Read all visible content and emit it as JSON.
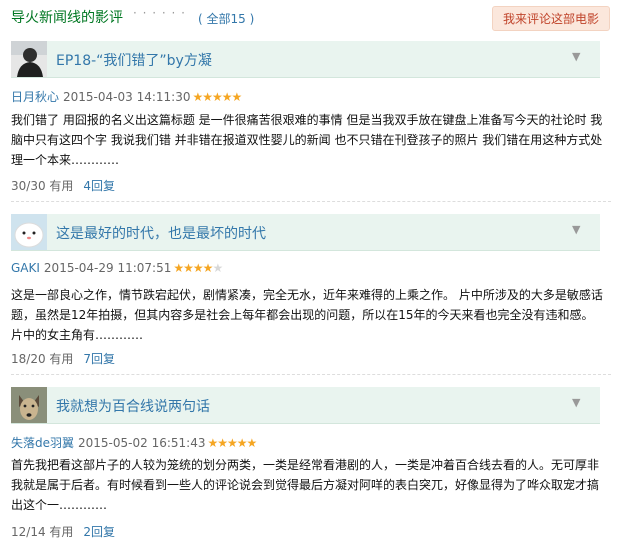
{
  "header": {
    "title": "导火新闻线的影评",
    "dots": "· · · · · ·",
    "count": "( 全部15 )",
    "write_button": "我来评论这部电影"
  },
  "reviews": [
    {
      "title": "EP18-“我们错了”by方凝",
      "author": "日月秋心",
      "date": "2015-04-03 14:11:30",
      "rating": 5,
      "avatar": "avatar-dark-figure",
      "body": "我们错了 用囧报的名义出这篇标题 是一件很痛苦很艰难的事情 但是当我双手放在键盘上准备写今天的社论时 我脑中只有这四个字 我说我们错 并非错在报道双性婴儿的新闻 也不只错在刊登孩子的照片 我们错在用这种方式处理一个本来…………",
      "useful": "30/30 有用",
      "replies": "4回复"
    },
    {
      "title": "这是最好的时代，也是最坏的时代",
      "author": "GAKI",
      "date": "2015-04-29 11:07:51",
      "rating": 4,
      "avatar": "avatar-white-creature",
      "body": "这是一部良心之作，情节跌宕起伏，剧情紧凑，完全无水，近年来难得的上乘之作。 片中所涉及的大多是敏感话题，虽然是12年拍摄，但其内容多是社会上每年都会出现的问题，所以在15年的今天来看也完全没有违和感。 片中的女主角有…………",
      "useful": "18/20 有用",
      "replies": "7回复"
    },
    {
      "title": "我就想为百合线说两句话",
      "author": "失落de羽翼",
      "date": "2015-05-02 16:51:43",
      "rating": 5,
      "avatar": "avatar-dog",
      "body": "首先我把看这部片子的人较为笼统的划分两类，一类是经常看港剧的人，一类是冲着百合线去看的人。无可厚非我就是属于后者。有时候看到一些人的评论说会到觉得最后方凝对阿咩的表白突兀，好像显得为了哗众取宠才搞出这个一…………",
      "useful": "12/14 有用",
      "replies": "2回复"
    }
  ],
  "icons": {
    "caret": "caret-down-icon",
    "star": "star-icon"
  },
  "colors": {
    "link": "#3377aa",
    "title_green": "#007722",
    "bar_bg": "#e9f4ef",
    "star": "#f5a623",
    "button_bg": "#fbe7dc"
  }
}
